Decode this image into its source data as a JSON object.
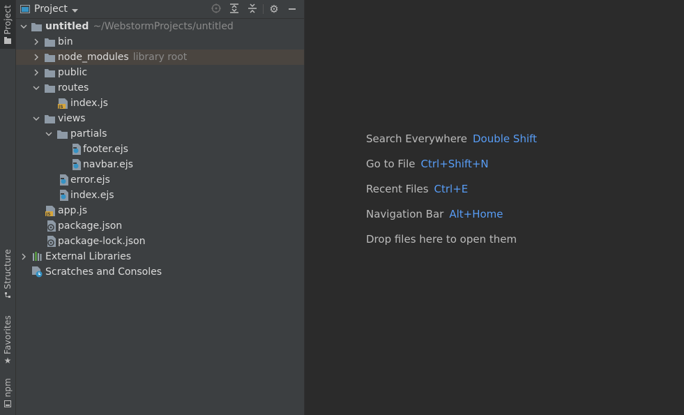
{
  "side_strip": {
    "project_tab": "Project",
    "structure_tab": "Structure",
    "favorites_tab": "Favorites",
    "npm_tab": "npm"
  },
  "panel": {
    "title": "Project"
  },
  "tree": {
    "root_name": "untitled",
    "root_path": "~/WebstormProjects/untitled",
    "bin": "bin",
    "node_modules": "node_modules",
    "node_modules_hint": "library root",
    "public": "public",
    "routes": "routes",
    "routes_index": "index.js",
    "views": "views",
    "partials": "partials",
    "footer": "footer.ejs",
    "navbar": "navbar.ejs",
    "error": "error.ejs",
    "views_index": "index.ejs",
    "app": "app.js",
    "package": "package.json",
    "package_lock": "package-lock.json",
    "external": "External Libraries",
    "scratches": "Scratches and Consoles"
  },
  "editor": {
    "hints": [
      {
        "label": "Search Everywhere",
        "shortcut": "Double Shift"
      },
      {
        "label": "Go to File",
        "shortcut": "Ctrl+Shift+N"
      },
      {
        "label": "Recent Files",
        "shortcut": "Ctrl+E"
      },
      {
        "label": "Navigation Bar",
        "shortcut": "Alt+Home"
      },
      {
        "label": "Drop files here to open them",
        "shortcut": ""
      }
    ]
  },
  "colors": {
    "background": "#2b2b2b",
    "panel": "#3c3f41",
    "selection": "#4a4540",
    "shortcut": "#589df6",
    "folder": "#8e9aa6",
    "js_badge": "#d6a53a"
  }
}
